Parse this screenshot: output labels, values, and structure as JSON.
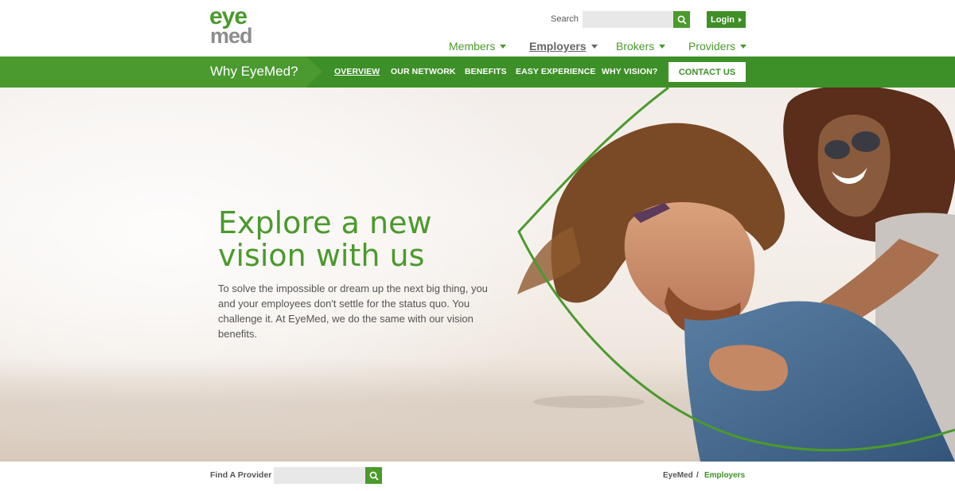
{
  "brand": {
    "logo_top": "eye",
    "logo_bottom": "med",
    "logo_top_color": "#4a9a2c",
    "logo_bottom_color": "#8d8d8d"
  },
  "header": {
    "search_label": "Search",
    "search_placeholder": "",
    "login_label": "Login",
    "nav": [
      {
        "label": "Members",
        "active": false
      },
      {
        "label": "Employers",
        "active": true
      },
      {
        "label": "Brokers",
        "active": false
      },
      {
        "label": "Providers",
        "active": false
      }
    ]
  },
  "subbar": {
    "title": "Why EyeMed?",
    "items": [
      {
        "label": "OVERVIEW",
        "active": true
      },
      {
        "label": "OUR NETWORK",
        "active": false
      },
      {
        "label": "BENEFITS",
        "active": false
      },
      {
        "label": "EASY EXPERIENCE",
        "active": false
      },
      {
        "label": "WHY VISION?",
        "active": false
      }
    ],
    "contact_label": "CONTACT US"
  },
  "hero": {
    "title_line1": "Explore a new",
    "title_line2": "vision with us",
    "body": "To solve the impossible or dream up the next big thing, you and your employees don't settle for the status quo. You challenge it. At EyeMed, we do the same with our vision benefits."
  },
  "footer": {
    "find_label": "Find A Provider",
    "find_placeholder": "",
    "breadcrumb_home": "EyeMed",
    "breadcrumb_sep": "/",
    "breadcrumb_current": "Employers"
  },
  "colors": {
    "brand_green": "#4a9a2c",
    "dark_green": "#3d8f28",
    "text_gray": "#555555"
  },
  "icons": {
    "search": "search-icon",
    "login_caret": "caret-right-icon",
    "nav_caret": "caret-down-icon"
  }
}
